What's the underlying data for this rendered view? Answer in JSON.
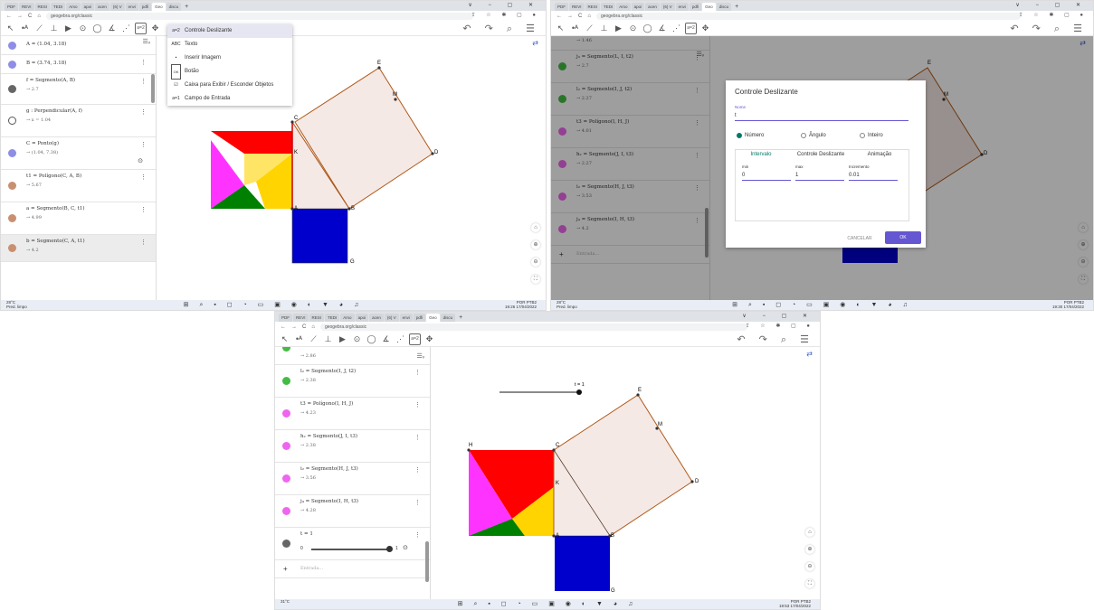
{
  "browser": {
    "tabs": [
      "PDF",
      "REVI",
      "RESI",
      "TEDI",
      "Amo",
      "apoi",
      "acen",
      "(6) V",
      "envi",
      "pdfi",
      "Geo",
      "discu"
    ],
    "new_tab": "+",
    "url": "geogebra.org/classic",
    "window_controls": "∨ − ▢ ✕",
    "url_icons": "⇪ ☆ ✱ ▢ ●"
  },
  "shot1": {
    "algebra": [
      {
        "def": "A = (1.04, 3.18)",
        "color": "#8e8ee6"
      },
      {
        "def": "B = (3.74, 3.18)",
        "color": "#8e8ee6"
      },
      {
        "def": "f = Segmento(A, B)",
        "val": "→ 2.7",
        "color": "#666666"
      },
      {
        "def": "g : Perpendicular(A, f)",
        "val": "→ x = 1.04",
        "color": "#ffffff"
      },
      {
        "def": "C = Ponto(g)",
        "val": "→ (1.04, 7.38)",
        "color": "#8e8ee6"
      },
      {
        "def": "t1 = Polígono(C, A, B)",
        "val": "→ 5.67",
        "color": "#c89070"
      },
      {
        "def": "a = Segmento(B, C, t1)",
        "val": "→ 4.99",
        "color": "#c89070"
      },
      {
        "def": "b = Segmento(C, A, t1)",
        "val": "→ 4.2",
        "color": "#c89070"
      }
    ],
    "menu": [
      {
        "icon": "a=2",
        "label": "Controle Deslizante"
      },
      {
        "icon": "ABC",
        "label": "Texto"
      },
      {
        "icon": "▪",
        "label": "Inserir Imagem"
      },
      {
        "icon": "OK",
        "label": "Botão"
      },
      {
        "icon": "☑",
        "label": "Caixa para Exibir / Esconder Objetos"
      },
      {
        "icon": "a=1",
        "label": "Campo de Entrada"
      }
    ],
    "taskbar_left": "28°C\nPred. limpo",
    "taskbar_right": "POR PTB2\n19:26 17/04/2022",
    "points": [
      "E",
      "M",
      "C",
      "D",
      "K",
      "A",
      "B",
      "G"
    ]
  },
  "shot2": {
    "algebra": [
      {
        "def": "",
        "val": "→ 1.46",
        "color": "#cc66cc"
      },
      {
        "def": "j₃ = Segmento(L, I, t2)",
        "val": "→ 2.7",
        "color": "#44bb44"
      },
      {
        "def": "l₂ = Segmento(I, J, t2)",
        "val": "→ 2.27",
        "color": "#44bb44"
      },
      {
        "def": "t3 = Polígono(I, H, J)",
        "val": "→ 4.01",
        "color": "#ee66ee"
      },
      {
        "def": "h₂ = Segmento(J, I, t3)",
        "val": "→ 2.27",
        "color": "#ee66ee"
      },
      {
        "def": "i₂ = Segmento(H, J, t3)",
        "val": "→ 3.53",
        "color": "#ee66ee"
      },
      {
        "def": "j₄ = Segmento(I, H, t3)",
        "val": "→ 4.2",
        "color": "#ee66ee"
      }
    ],
    "input_placeholder": "Entrada...",
    "dialog": {
      "title": "Controle Deslizante",
      "name_label": "Nome",
      "name_value": "t",
      "radios": [
        "Número",
        "Ângulo",
        "Inteiro"
      ],
      "tabs": [
        "Intervalo",
        "Controle Deslizante",
        "Animação"
      ],
      "min_label": "min",
      "min": "0",
      "max_label": "max",
      "max": "1",
      "inc_label": "Incremento",
      "inc": "0.01",
      "cancel": "CANCELAR",
      "ok": "OK"
    },
    "points": [
      "E",
      "M",
      "D"
    ],
    "taskbar_left": "28°C\nPred. limpo",
    "taskbar_right": "POR PTB2\n19:30 17/04/2022"
  },
  "shot3": {
    "algebra": [
      {
        "def": "",
        "val": "→ 2.86",
        "color": "#44bb44"
      },
      {
        "def": "l₂ = Segmento(I, J, t2)",
        "val": "→ 2.38",
        "color": "#44bb44"
      },
      {
        "def": "t3 = Polígono(I, H, J)",
        "val": "→ 4.23",
        "color": "#ee66ee"
      },
      {
        "def": "h₂ = Segmento(J, I, t3)",
        "val": "→ 2.38",
        "color": "#ee66ee"
      },
      {
        "def": "i₂ = Segmento(H, J, t3)",
        "val": "→ 3.56",
        "color": "#ee66ee"
      },
      {
        "def": "j₄ = Segmento(I, H, t3)",
        "val": "→ 4.28",
        "color": "#ee66ee"
      }
    ],
    "slider_def": "t = 1",
    "slider_min": "0",
    "slider_max": "1",
    "slider_level": 1,
    "slider_label": "t = 1",
    "input_placeholder": "Entrada...",
    "points": [
      "E",
      "M",
      "H",
      "C",
      "D",
      "K",
      "A",
      "B",
      "G"
    ],
    "taskbar_left": "31°C",
    "taskbar_right": "POR PTB2\n19:53 17/04/2022"
  },
  "colors": {
    "red": "#ff0000",
    "yellow": "#ffd400",
    "magenta": "#ff33ff",
    "green": "#008000",
    "blue": "#0000cc",
    "square": "#f5e9e6",
    "edge": "#b05a1a"
  },
  "toolbar_icons": [
    "move-icon",
    "point-icon",
    "line-icon",
    "perpendicular-icon",
    "polygon-icon",
    "circle-icon",
    "ellipse-icon",
    "angle-icon",
    "reflect-icon",
    "slider-icon",
    "pan-icon"
  ],
  "toolbar_glyphs": [
    "↖",
    "•ᴬ",
    "⟋",
    "⊥",
    "▶",
    "⊙",
    "◯",
    "∡",
    "⋰",
    "a=2",
    "✥"
  ],
  "toolbar_right": "↶ ↷ ⌕ ☰",
  "sort_icon": "☰ᵥ",
  "graphics_icon": "⇄",
  "side_buttons": [
    "⌂",
    "⊕",
    "⊖",
    "⛶"
  ],
  "taskbar_icons": "⊞ ⌕ ▪ ◻ ◔ ▭ ▣ ◉ ◐ ▼ ◕ ♫"
}
